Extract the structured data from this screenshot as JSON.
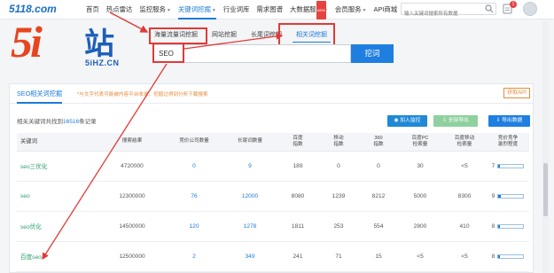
{
  "brand": {
    "small_logo": "5118.com",
    "big_logo_number": "5i",
    "big_logo_char": "站",
    "big_logo_url": "5iHZ.CN"
  },
  "nav": {
    "items": [
      {
        "label": "首页",
        "active": false
      },
      {
        "label": "热点雷达",
        "active": false
      },
      {
        "label": "监控服务",
        "active": false,
        "dropdown": true
      },
      {
        "label": "关键词挖掘",
        "active": true,
        "dropdown": true
      },
      {
        "label": "行业词库",
        "active": false
      },
      {
        "label": "需求图谱",
        "active": false
      },
      {
        "label": "大数据服务",
        "active": false,
        "dropdown": true,
        "badge": "NEW"
      },
      {
        "label": "会员服务",
        "active": false,
        "dropdown": true
      },
      {
        "label": "API商城",
        "active": false
      }
    ],
    "search_placeholder": "输入关键词搜索所有数据",
    "message_count": "1"
  },
  "subtabs": [
    {
      "label": "海量流量词挖掘",
      "active": false
    },
    {
      "label": "网站挖掘",
      "active": false
    },
    {
      "label": "长尾词挖掘",
      "active": false
    },
    {
      "label": "相关词挖掘",
      "active": true
    }
  ],
  "search": {
    "value": "SEO",
    "button": "挖词"
  },
  "panel": {
    "title": "SEO相关词挖掘",
    "note": "*与文字代表可能被内容平台收录，挖掘过得到分析下载搜索",
    "api_button": "获取API",
    "count_prefix": "相关关键词共找到",
    "count_value": "16516",
    "count_suffix": "条记录",
    "buttons": {
      "monitor": "加入监控",
      "export_all": "全部导出",
      "export": "导出数据"
    }
  },
  "table": {
    "headers": [
      "关键词",
      "搜索结果",
      "竞价公司数量",
      "长尾词数量",
      "百度\n指数",
      "移动\n指数",
      "360\n指数",
      "百度PC\n检索量",
      "百度移动\n检索量",
      "竞价竞争\n激烈程度"
    ],
    "rows": [
      {
        "keyword": "seo三优化",
        "results": "4720000",
        "companies": "0",
        "longtail": "9",
        "baidu": "189",
        "mobile": "0",
        "s360": "0",
        "pc": "30",
        "mob_search": "<5",
        "competition": "7",
        "competition_level": 0.07
      },
      {
        "keyword": "seo",
        "results": "12300000",
        "companies": "76",
        "longtail": "12000",
        "baidu": "8080",
        "mobile": "1239",
        "s360": "8212",
        "pc": "5000",
        "mob_search": "8300",
        "competition": "9",
        "competition_level": 0.09
      },
      {
        "keyword": "seo优化",
        "results": "14500000",
        "companies": "120",
        "longtail": "1278",
        "baidu": "1811",
        "mobile": "253",
        "s360": "554",
        "pc": "2800",
        "mob_search": "410",
        "competition": "8",
        "competition_level": 0.08
      },
      {
        "keyword": "百度seo",
        "results": "12500000",
        "companies": "2",
        "longtail": "349",
        "baidu": "241",
        "mobile": "71",
        "s360": "15",
        "pc": "<5",
        "mob_search": "<5",
        "competition": "8",
        "competition_level": 0.08
      }
    ]
  },
  "colors": {
    "accent": "#1a7bd9",
    "highlight": "#e23a37",
    "keyword_green": "#2aa06a",
    "note_orange": "#e58b3a"
  }
}
